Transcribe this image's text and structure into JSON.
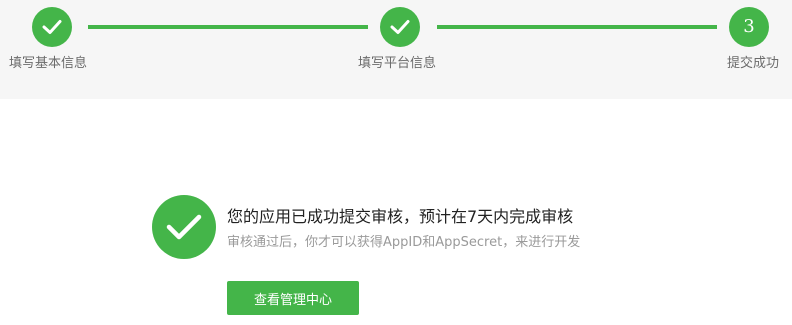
{
  "steps": [
    {
      "label": "填写基本信息",
      "status": "completed",
      "icon": "check-icon"
    },
    {
      "label": "填写平台信息",
      "status": "completed",
      "icon": "check-icon"
    },
    {
      "label": "提交成功",
      "status": "current",
      "number": "3"
    }
  ],
  "result": {
    "icon": "check-icon",
    "title": "您的应用已成功提交审核，预计在7天内完成审核",
    "description": "审核通过后，你才可以获得AppID和AppSecret，来进行开发",
    "button_label": "查看管理中心"
  },
  "colors": {
    "accent": "#44b549",
    "header_bg": "#f6f6f6",
    "label_text": "#6b6b6b",
    "title_text": "#222222",
    "desc_text": "#9a9a9a"
  }
}
